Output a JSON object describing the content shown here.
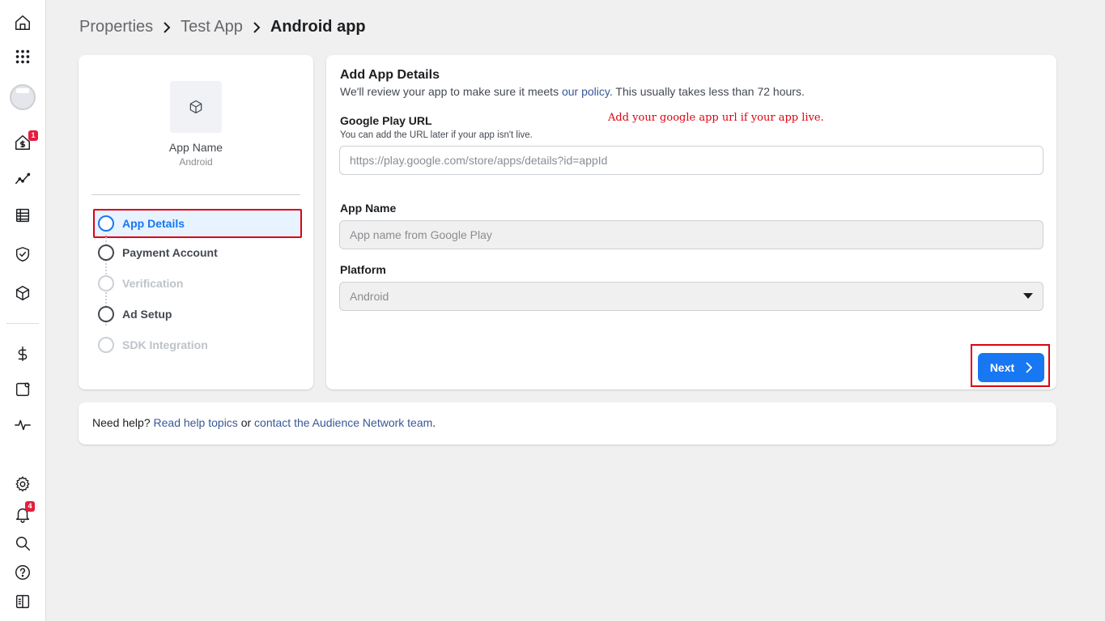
{
  "rail": {
    "badges": {
      "monetization": "1",
      "notifications": "4"
    }
  },
  "breadcrumb": {
    "items": [
      "Properties",
      "Test App"
    ],
    "current": "Android app"
  },
  "app_card": {
    "name": "App Name",
    "platform": "Android"
  },
  "steps": [
    {
      "label": "App Details",
      "state": "active"
    },
    {
      "label": "Payment Account",
      "state": "pending"
    },
    {
      "label": "Verification",
      "state": "disabled"
    },
    {
      "label": "Ad Setup",
      "state": "pending"
    },
    {
      "label": "SDK Integration",
      "state": "disabled"
    }
  ],
  "form": {
    "title": "Add App Details",
    "desc_before": "We'll review your app to make sure it meets ",
    "desc_link": "our policy",
    "desc_after": ". This usually takes less than 72 hours.",
    "google_play_label": "Google Play URL",
    "google_play_hint": "You can add the URL later if your app isn't live.",
    "annotation": "Add your google app url if your app live.",
    "google_play_placeholder": "https://play.google.com/store/apps/details?id=appId",
    "app_name_label": "App Name",
    "app_name_placeholder": "App name from Google Play",
    "platform_label": "Platform",
    "platform_value": "Android",
    "next_label": "Next"
  },
  "help": {
    "prefix": "Need help? ",
    "link1": "Read help topics",
    "middle": " or ",
    "link2": "contact the Audience Network team",
    "suffix": "."
  },
  "colors": {
    "accent": "#1877f2",
    "highlight_border": "#e0000f",
    "badge": "#e41e3f"
  }
}
